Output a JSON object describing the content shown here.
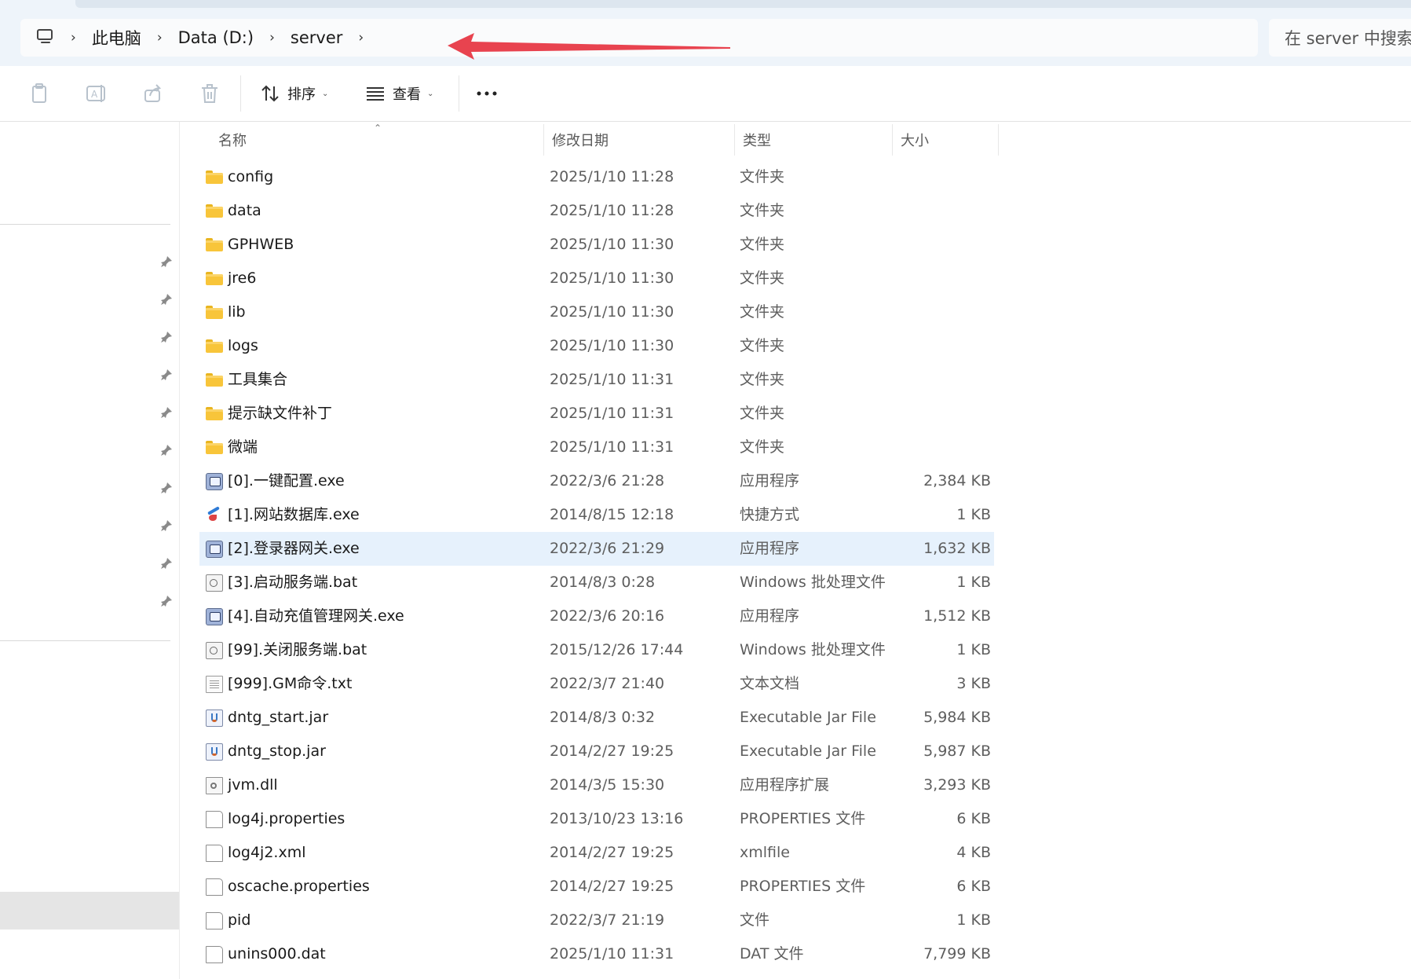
{
  "address": {
    "crumbs": [
      "此电脑",
      "Data (D:)",
      "server"
    ],
    "search_placeholder": "在 server 中搜索",
    "arrow_color": "#e8434f"
  },
  "toolbar": {
    "copy_icon": "copy-icon",
    "rename_icon": "rename-icon",
    "share_icon": "share-icon",
    "delete_icon": "delete-icon",
    "sort_label": "排序",
    "view_label": "查看",
    "more_icon": "more-icon"
  },
  "columns": {
    "name": "名称",
    "date": "修改日期",
    "type": "类型",
    "size": "大小"
  },
  "files": [
    {
      "name": "config",
      "date": "2025/1/10 11:28",
      "type": "文件夹",
      "size": "",
      "icon": "folder-icon"
    },
    {
      "name": "data",
      "date": "2025/1/10 11:28",
      "type": "文件夹",
      "size": "",
      "icon": "folder-icon"
    },
    {
      "name": "GPHWEB",
      "date": "2025/1/10 11:30",
      "type": "文件夹",
      "size": "",
      "icon": "folder-icon"
    },
    {
      "name": "jre6",
      "date": "2025/1/10 11:30",
      "type": "文件夹",
      "size": "",
      "icon": "folder-icon"
    },
    {
      "name": "lib",
      "date": "2025/1/10 11:30",
      "type": "文件夹",
      "size": "",
      "icon": "folder-icon"
    },
    {
      "name": "logs",
      "date": "2025/1/10 11:30",
      "type": "文件夹",
      "size": "",
      "icon": "folder-icon"
    },
    {
      "name": "工具集合",
      "date": "2025/1/10 11:31",
      "type": "文件夹",
      "size": "",
      "icon": "folder-icon"
    },
    {
      "name": "提示缺文件补丁",
      "date": "2025/1/10 11:31",
      "type": "文件夹",
      "size": "",
      "icon": "folder-icon"
    },
    {
      "name": "微端",
      "date": "2025/1/10 11:31",
      "type": "文件夹",
      "size": "",
      "icon": "folder-icon"
    },
    {
      "name": "[0].一键配置.exe",
      "date": "2022/3/6 21:28",
      "type": "应用程序",
      "size": "2,384 KB",
      "icon": "exe-icon"
    },
    {
      "name": "[1].网站数据库.exe",
      "date": "2014/8/15 12:18",
      "type": "快捷方式",
      "size": "1 KB",
      "icon": "shortcut-icon"
    },
    {
      "name": "[2].登录器网关.exe",
      "date": "2022/3/6 21:29",
      "type": "应用程序",
      "size": "1,632 KB",
      "icon": "exe-icon",
      "selected": true
    },
    {
      "name": "[3].启动服务端.bat",
      "date": "2014/8/3 0:28",
      "type": "Windows 批处理文件",
      "size": "1 KB",
      "icon": "bat-icon"
    },
    {
      "name": "[4].自动充值管理网关.exe",
      "date": "2022/3/6 20:16",
      "type": "应用程序",
      "size": "1,512 KB",
      "icon": "exe-icon"
    },
    {
      "name": "[99].关闭服务端.bat",
      "date": "2015/12/26 17:44",
      "type": "Windows 批处理文件",
      "size": "1 KB",
      "icon": "bat-icon"
    },
    {
      "name": "[999].GM命令.txt",
      "date": "2022/3/7 21:40",
      "type": "文本文档",
      "size": "3 KB",
      "icon": "txt-icon"
    },
    {
      "name": "dntg_start.jar",
      "date": "2014/8/3 0:32",
      "type": "Executable Jar File",
      "size": "5,984 KB",
      "icon": "jar-icon"
    },
    {
      "name": "dntg_stop.jar",
      "date": "2014/2/27 19:25",
      "type": "Executable Jar File",
      "size": "5,987 KB",
      "icon": "jar-icon"
    },
    {
      "name": "jvm.dll",
      "date": "2014/3/5 15:30",
      "type": "应用程序扩展",
      "size": "3,293 KB",
      "icon": "dll-icon"
    },
    {
      "name": "log4j.properties",
      "date": "2013/10/23 13:16",
      "type": "PROPERTIES 文件",
      "size": "6 KB",
      "icon": "file-icon"
    },
    {
      "name": "log4j2.xml",
      "date": "2014/2/27 19:25",
      "type": "xmlfile",
      "size": "4 KB",
      "icon": "file-icon"
    },
    {
      "name": "oscache.properties",
      "date": "2014/2/27 19:25",
      "type": "PROPERTIES 文件",
      "size": "6 KB",
      "icon": "file-icon"
    },
    {
      "name": "pid",
      "date": "2022/3/7 21:19",
      "type": "文件",
      "size": "1 KB",
      "icon": "file-icon"
    },
    {
      "name": "unins000.dat",
      "date": "2025/1/10 11:31",
      "type": "DAT 文件",
      "size": "7,799 KB",
      "icon": "file-icon"
    }
  ]
}
